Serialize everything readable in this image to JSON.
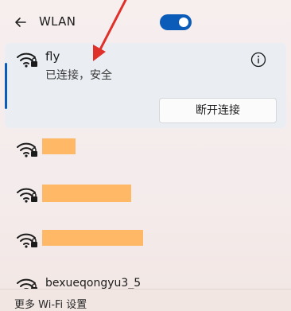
{
  "header": {
    "title": "WLAN",
    "back_icon": "back-arrow-icon",
    "toggle_on": true,
    "accent_color": "#0b5cb8"
  },
  "connected_network": {
    "name": "fly",
    "status": "已连接，安全",
    "info_icon": "info-icon",
    "disconnect_label": "断开连接"
  },
  "networks": [
    {
      "name": "",
      "redacted": true
    },
    {
      "name": "",
      "redacted": true
    },
    {
      "name": "",
      "redacted": true
    },
    {
      "name": "bexueqongyu3_5",
      "redacted": false
    }
  ],
  "footer": {
    "more_settings_label": "更多 Wi-Fi 设置"
  },
  "colors": {
    "redaction": "#ffb866",
    "annotation_arrow": "#e0302a"
  }
}
